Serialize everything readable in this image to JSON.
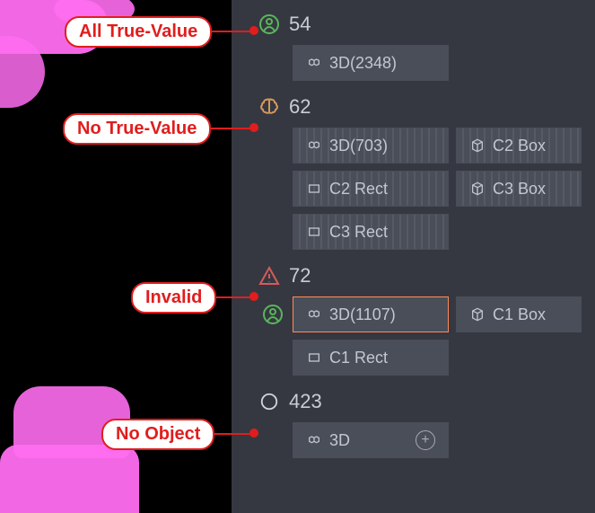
{
  "callouts": {
    "allTrue": "All True-Value",
    "noTrue": "No True-Value",
    "invalid": "Invalid",
    "noObject": "No Object"
  },
  "groups": {
    "g54": {
      "count": "54",
      "status": "person"
    },
    "g62": {
      "count": "62",
      "status": "brain"
    },
    "g72": {
      "count": "72",
      "status": "warning"
    },
    "g423": {
      "count": "423",
      "status": "circle"
    }
  },
  "chips": {
    "g54_3d": "3D(2348)",
    "g62_3d": "3D(703)",
    "g62_c2box": "C2 Box",
    "g62_c2rect": "C2 Rect",
    "g62_c3box": "C3 Box",
    "g62_c3rect": "C3 Rect",
    "g72_3d": "3D(1107)",
    "g72_c1box": "C1 Box",
    "g72_c1rect": "C1 Rect",
    "g423_3d": "3D"
  }
}
